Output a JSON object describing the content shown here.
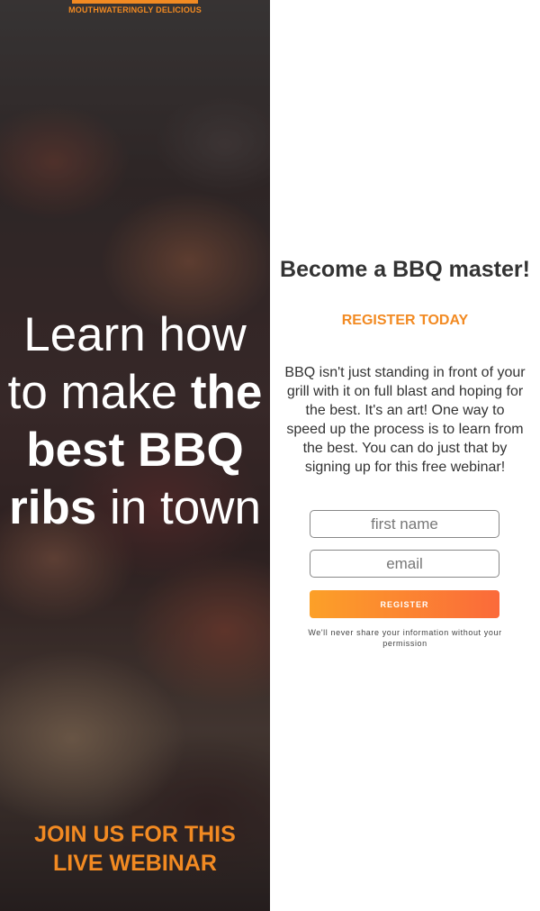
{
  "hero": {
    "tagline": "MOUTHWATERINGLY DELICIOUS",
    "headline_part1": "Learn how to make ",
    "headline_bold1": "the best BBQ ribs",
    "headline_part2": " in town",
    "webinar_line1": "JOIN US FOR THIS",
    "webinar_line2": "LIVE WEBINAR"
  },
  "form_panel": {
    "title": "Become a BBQ master!",
    "subtitle": "REGISTER TODAY",
    "body": "BBQ isn't just standing in front of your grill with it on full blast and hoping for the best. It's an art! One way to speed up the process is to learn from the best. You can do just that by signing up for this free webinar!",
    "first_name_placeholder": "first name",
    "email_placeholder": "email",
    "register_label": "REGISTER",
    "privacy_note": "We'll never share your information without your permission"
  },
  "colors": {
    "accent": "#f28a22",
    "button_start": "#fca028",
    "button_end": "#fb6a3a",
    "text_dark": "#333333"
  }
}
